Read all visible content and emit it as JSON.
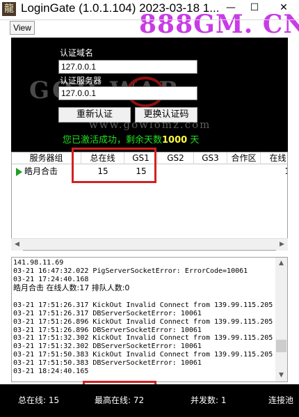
{
  "window": {
    "icon_glyph": "龍",
    "title": "LoginGate (1.0.1.104)   2023-03-18 1...",
    "minimize": "—",
    "maximize": "☐",
    "close": "✕"
  },
  "watermark": "888GM. CN",
  "menu": {
    "view": "View"
  },
  "auth": {
    "domain_label": "认证域名",
    "domain_value": "127.0.0.1",
    "server_label": "认证服务器",
    "server_value": "127.0.0.1",
    "reauth_button": "重新认证",
    "change_code_button": "更换认证码",
    "status_prefix": "您已激活成功，剩余天数",
    "days": "1000",
    "days_unit": "天"
  },
  "banner": {
    "art": "GOD  WAR",
    "site": "www.gowlomz.com"
  },
  "grid": {
    "columns": [
      "服务器组",
      "总在线",
      "GS1",
      "GS2",
      "GS3",
      "合作区",
      "在线"
    ],
    "rows": [
      {
        "group": "皓月合击",
        "total": "15",
        "gs1": "15",
        "gs2": "",
        "gs3": "",
        "coop": "",
        "online": "1"
      }
    ]
  },
  "log": {
    "lines": [
      "141.98.11.69",
      "03-21 16:47:32.022 PigServerSocketError: ErrorCode=10061",
      "03-21 17:24:40.168",
      "皓月合击 在线人数:17 排队人数:0",
      "",
      "03-21 17:51:26.317 KickOut Invalid Connect from 139.99.115.205",
      "03-21 17:51:26.317 DBServerSocketError: 10061",
      "03-21 17:51:26.896 KickOut Invalid Connect from 139.99.115.205",
      "03-21 17:51:26.896 DBServerSocketError: 10061",
      "03-21 17:51:32.302 KickOut Invalid Connect from 139.99.115.205",
      "03-21 17:51:32.302 DBServerSocketError: 10061",
      "03-21 17:51:50.383 KickOut Invalid Connect from 139.99.115.205",
      "03-21 17:51:50.383 DBServerSocketError: 10061",
      "03-21 18:24:40.165"
    ]
  },
  "status": {
    "total_online": "总在线: 15",
    "peak_online": "最高在线: 72",
    "concurrent": "并发数: 1",
    "connection": "连接池"
  },
  "colors": {
    "highlight": "#d42020",
    "success_text": "#20e020",
    "days_text": "#ffff40"
  }
}
